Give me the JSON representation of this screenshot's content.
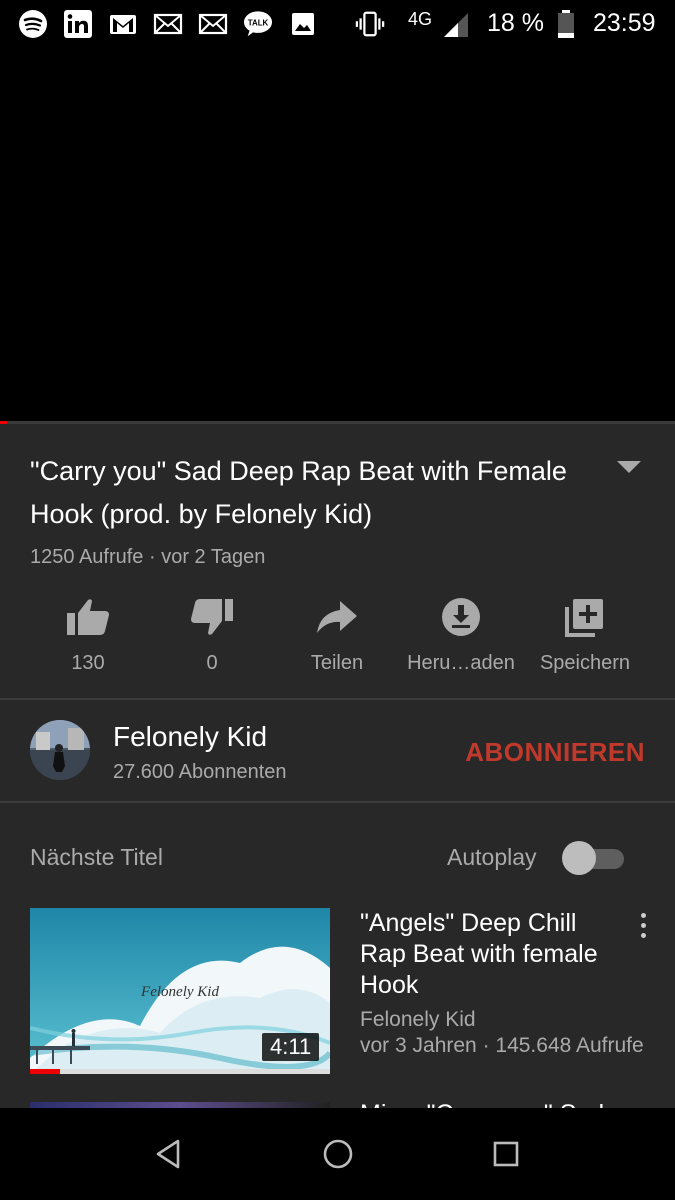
{
  "status_bar": {
    "icons": [
      "spotify-icon",
      "linkedin-icon",
      "gmail-icon",
      "mail-icon",
      "mail-icon",
      "kakaotalk-icon",
      "image-icon",
      "vibrate-icon"
    ],
    "talk_label": "TALK",
    "network": "4G",
    "battery": "18 %",
    "time": "23:59"
  },
  "player": {
    "progress": 0.01
  },
  "video": {
    "title": "\"Carry you\" Sad Deep Rap Beat with Female Hook (prod. by Felonely Kid)",
    "meta": "1250 Aufrufe · vor 2 Tagen"
  },
  "actions": [
    {
      "icon": "thumbs-up-icon",
      "label": "130"
    },
    {
      "icon": "thumbs-down-icon",
      "label": "0"
    },
    {
      "icon": "share-icon",
      "label": "Teilen"
    },
    {
      "icon": "download-icon",
      "label": "Heru…aden"
    },
    {
      "icon": "add-to-playlist-icon",
      "label": "Speichern"
    }
  ],
  "channel": {
    "name": "Felonely Kid",
    "subscribers": "27.600 Abonnenten",
    "subscribe_label": "ABONNIEREN"
  },
  "up_next": {
    "heading": "Nächste Titel",
    "autoplay_label": "Autoplay",
    "autoplay_on": false
  },
  "recommended": [
    {
      "title": "\"Angels\" Deep Chill Rap Beat with female Hook",
      "channel": "Felonely Kid",
      "meta": "vor 3 Jahren · 145.648 Aufrufe",
      "duration": "4:11",
      "thumbnail_text": "Felonely Kid",
      "watched_progress": 0.1
    },
    {
      "title": "Mix – \"Carry you\" Sad"
    }
  ],
  "nav_bar": {
    "icons": [
      "back-icon",
      "home-icon",
      "recents-icon"
    ]
  },
  "colors": {
    "panel": "#282828",
    "accent_red": "#c0392b",
    "progress_red": "#ee0000",
    "muted_text": "#aaaaaa"
  }
}
